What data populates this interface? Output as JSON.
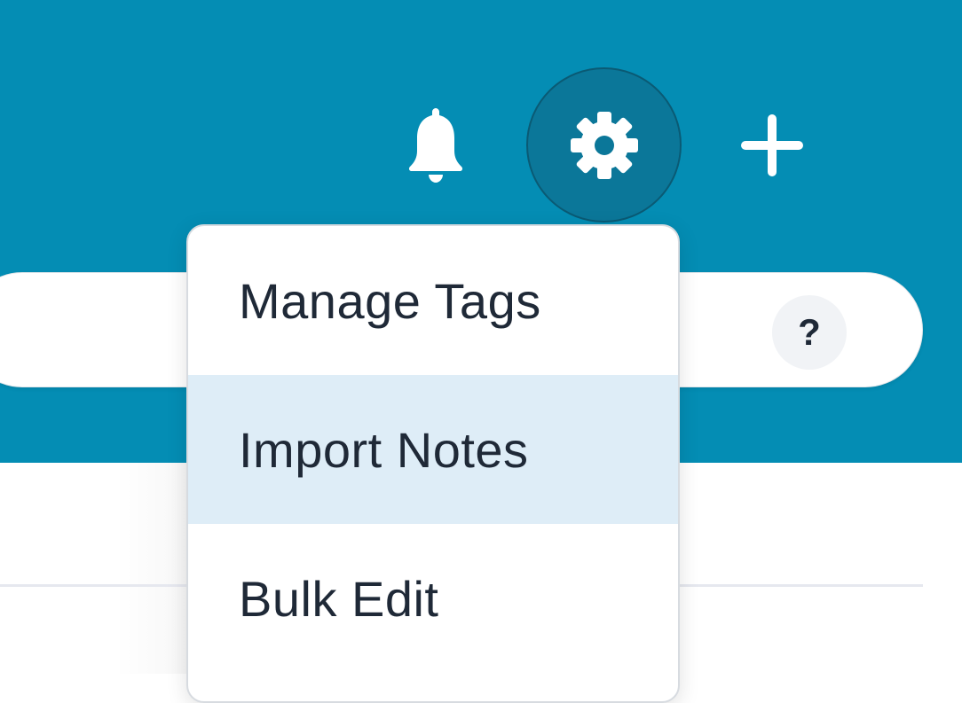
{
  "header": {
    "background": "#048db4",
    "icons": {
      "notifications": "bell-icon",
      "settings": "gear-icon",
      "create": "plus-icon"
    }
  },
  "search": {
    "help_label": "?"
  },
  "settings_menu": {
    "items": [
      {
        "label": "Manage Tags",
        "highlighted": false
      },
      {
        "label": "Import Notes",
        "highlighted": true
      },
      {
        "label": "Bulk Edit",
        "highlighted": false
      }
    ],
    "highlight_color": "#deedf7"
  }
}
